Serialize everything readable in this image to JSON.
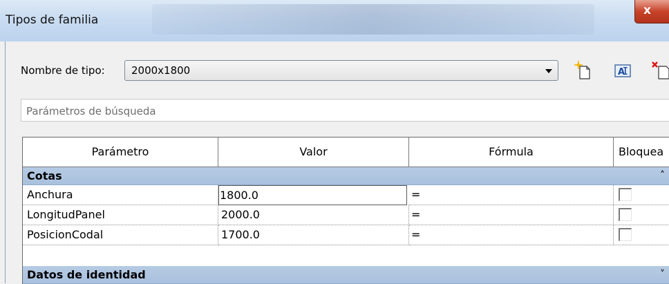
{
  "window": {
    "title": "Tipos de familia",
    "close_label": "x"
  },
  "type_selector": {
    "label": "Nombre de tipo:",
    "selected": "2000x1800"
  },
  "toolbar": {
    "icons": [
      "new-type-icon",
      "rename-type-icon",
      "delete-type-icon"
    ]
  },
  "search": {
    "placeholder": "Parámetros de búsqueda",
    "value": ""
  },
  "table": {
    "columns": [
      "Parámetro",
      "Valor",
      "Fórmula",
      "Bloquea"
    ],
    "groups": [
      {
        "label": "Cotas",
        "collapse_glyph": "˄",
        "rows": [
          {
            "param": "Anchura",
            "value": "1800.0",
            "formula": "=",
            "locked": false
          },
          {
            "param": "LongitudPanel",
            "value": "2000.0",
            "formula": "=",
            "locked": false
          },
          {
            "param": "PosicionCodal",
            "value": "1700.0",
            "formula": "=",
            "locked": false
          }
        ]
      },
      {
        "label": "Datos de identidad",
        "collapse_glyph": "˅",
        "rows": []
      }
    ]
  },
  "colors": {
    "group_header": "#b6cbe4",
    "title_bar": "#c9dcf1",
    "close_button": "#c7432a"
  }
}
